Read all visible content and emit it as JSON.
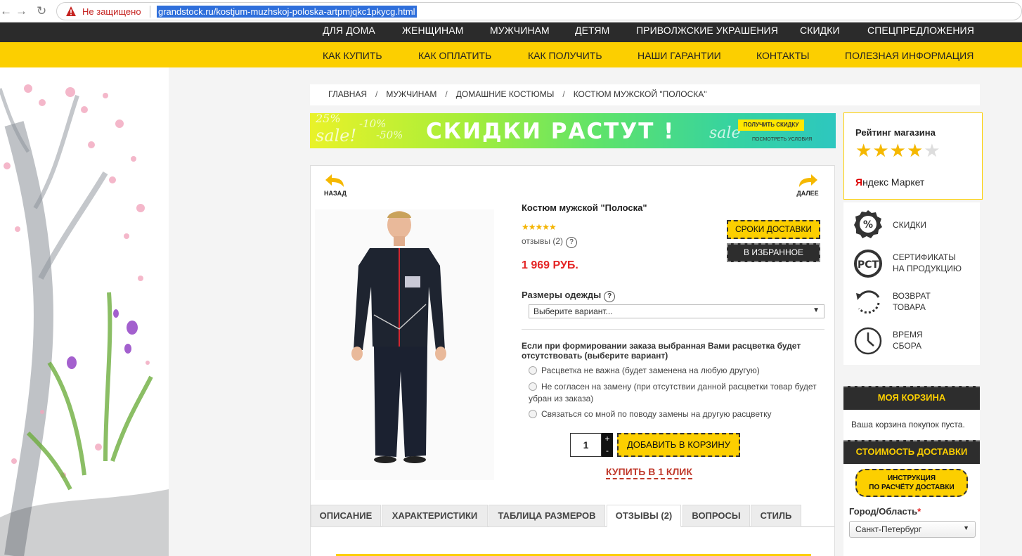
{
  "browser": {
    "insecure_label": "Не защищено",
    "url": "grandstock.ru/kostjum-muzhskoj-poloska-artpmjqkc1pkycg.html"
  },
  "top_nav": [
    "ДЛЯ ДОМА",
    "ЖЕНЩИНАМ",
    "МУЖЧИНАМ",
    "ДЕТЯМ",
    "ПРИВОЛЖСКИЕ УКРАШЕНИЯ",
    "СКИДКИ",
    "СПЕЦПРЕДЛОЖЕНИЯ"
  ],
  "sub_nav": [
    "КАК КУПИТЬ",
    "КАК ОПЛАТИТЬ",
    "КАК ПОЛУЧИТЬ",
    "НАШИ ГАРАНТИИ",
    "КОНТАКТЫ",
    "ПОЛЕЗНАЯ ИНФОРМАЦИЯ"
  ],
  "breadcrumb": [
    "ГЛАВНАЯ",
    "МУЖЧИНАМ",
    "ДОМАШНИЕ КОСТЮМЫ",
    "КОСТЮМ МУЖСКОЙ \"ПОЛОСКА\""
  ],
  "banner": {
    "headline": "СКИДКИ РАСТУТ !",
    "button": "ПОЛУЧИТЬ СКИДКУ",
    "sub": "ПОСМОТРЕТЬ УСЛОВИЯ",
    "ghost1": "25%",
    "ghost2": "sale!",
    "ghost3": "-10%",
    "ghost4": "-50%",
    "ghost5": "sale"
  },
  "product": {
    "back": "НАЗАД",
    "next": "ДАЛЕЕ",
    "title": "Костюм мужской \"Полоска\"",
    "stars": "★★★★★",
    "reviews": "отзывы (2)",
    "price": "1 969 РУБ.",
    "delivery_btn": "СРОКИ ДОСТАВКИ",
    "favorite_btn": "В ИЗБРАННОЕ",
    "sizes_label": "Размеры одежды",
    "sizes_selected": "Выберите вариант...",
    "question": "Если при формировании заказа выбранная Вами расцветка будет отсутствовать (выберите вариант)",
    "options": [
      "Расцветка не важна (будет заменена на любую другую)",
      "Не согласен на замену (при отсутствии данной расцветки товар будет убран из заказа)",
      "Связаться со мной по поводу замены на другую расцветку"
    ],
    "qty": "1",
    "plus": "+",
    "minus": "-",
    "add_to_cart": "ДОБАВИТЬ В КОРЗИНУ",
    "one_click": "КУПИТЬ В 1 КЛИК"
  },
  "tabs": [
    "ОПИСАНИЕ",
    "ХАРАКТЕРИСТИКИ",
    "ТАБЛИЦА РАЗМЕРОВ",
    "ОТЗЫВЫ (2)",
    "ВОПРОСЫ",
    "СТИЛЬ"
  ],
  "sidebar": {
    "rating_title": "Рейтинг магазина",
    "rating_value": 4,
    "rating_max": 5,
    "market_brand": "Я",
    "market_rest": "ндекс Маркет",
    "features": [
      "СКИДКИ",
      "СЕРТИФИКАТЫ\nНА ПРОДУКЦИЮ",
      "ВОЗВРАТ\nТОВАРА",
      "ВРЕМЯ\nСБОРА"
    ],
    "cart_title": "МОЯ КОРЗИНА",
    "cart_empty": "Ваша корзина покупок пуста.",
    "delivery_cost_title": "СТОИМОСТЬ ДОСТАВКИ",
    "instruction": "ИНСТРУКЦИЯ\nПО РАСЧЁТУ ДОСТАВКИ",
    "region_label": "Город/Область",
    "region_required": "*",
    "region_value": "Санкт-Петербург"
  },
  "colors": {
    "accent_yellow": "#fccf00",
    "dark": "#2b2b2b",
    "price_red": "#e42424"
  }
}
